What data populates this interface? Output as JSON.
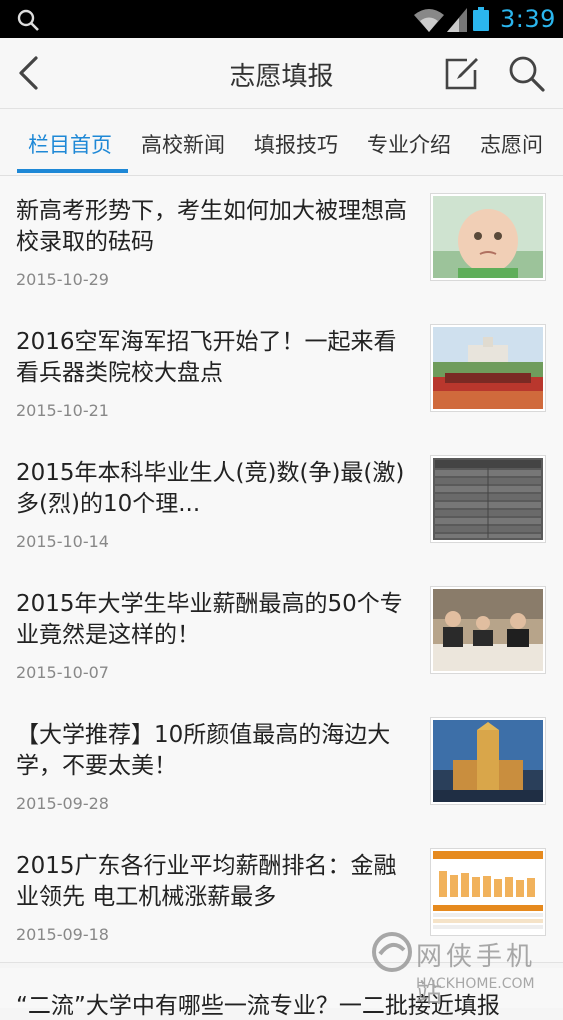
{
  "status_bar": {
    "time": "3:39"
  },
  "header": {
    "title": "志愿填报"
  },
  "tabs": [
    {
      "label": "栏目首页"
    },
    {
      "label": "高校新闻"
    },
    {
      "label": "填报技巧"
    },
    {
      "label": "专业介绍"
    },
    {
      "label": "志愿问"
    }
  ],
  "articles": [
    {
      "title": "新高考形势下，考生如何加大被理想高校录取的砝码",
      "date": "2015-10-29",
      "thumb": "baby-photo"
    },
    {
      "title": "2016空军海军招飞开始了！一起来看看兵器类院校大盘点",
      "date": "2015-10-21",
      "thumb": "campus-building-photo"
    },
    {
      "title": "2015年本科毕业生人(竞)数(争)最(激)多(烈)的10个理...",
      "date": "2015-10-14",
      "thumb": "data-table-image"
    },
    {
      "title": "2015年大学生毕业薪酬最高的50个专业竟然是这样的！",
      "date": "2015-10-07",
      "thumb": "meeting-photo"
    },
    {
      "title": "【大学推荐】10所颜值最高的海边大学，不要太美！",
      "date": "2015-09-28",
      "thumb": "tower-building-photo"
    },
    {
      "title": "2015广东各行业平均薪酬排名：金融业领先 电工机械涨薪最多",
      "date": "2015-09-18",
      "thumb": "salary-chart-image"
    }
  ],
  "partial_article": {
    "title": "“二流”大学中有哪些一流专业？一二批接近填报"
  },
  "watermark": {
    "text": "网侠手机站",
    "url": "HACKHOME.COM"
  }
}
